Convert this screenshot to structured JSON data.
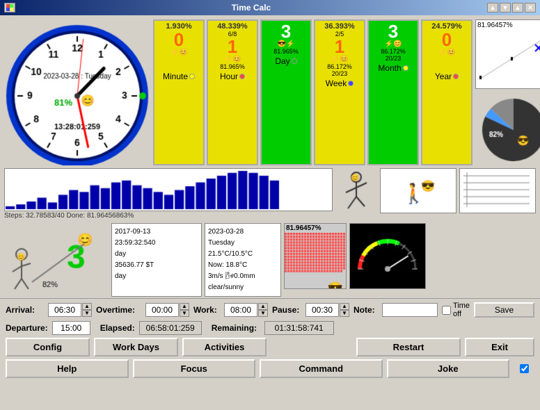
{
  "window": {
    "title": "Time Calc",
    "controls": [
      "▲",
      "▼",
      "▲",
      "✕"
    ]
  },
  "clock": {
    "date": "2023-03-28 : Tuesday",
    "time": "13:28:01:259",
    "percent": "81%"
  },
  "stats": [
    {
      "id": "minute",
      "percent": "1.930%",
      "fraction": "",
      "big": "0",
      "icons": "⚡😊",
      "sub_percent": "",
      "sub_fraction": "",
      "label": "Minute",
      "dot": "yellow",
      "bg": "yellow"
    },
    {
      "id": "hour",
      "percent": "48.339%",
      "fraction": "6/8",
      "big": "1",
      "icons": "⚡😊",
      "sub_percent": "81.965%",
      "sub_fraction": "",
      "label": "Hour",
      "dot": "red",
      "bg": "yellow"
    },
    {
      "id": "day",
      "percent": "",
      "fraction": "",
      "big": "3",
      "icons": "😎⚡",
      "sub_percent": "81.965%",
      "sub_fraction": "",
      "label": "Day",
      "dot": "green",
      "bg": "green"
    },
    {
      "id": "week",
      "percent": "36.393%",
      "fraction": "2/5",
      "big": "1",
      "icons": "⚡😊",
      "sub_percent": "86.172%",
      "sub_fraction": "20/23",
      "label": "Week",
      "dot": "blue",
      "bg": "yellow"
    },
    {
      "id": "month",
      "percent": "",
      "fraction": "",
      "big": "3",
      "icons": "⚡😊",
      "sub_percent": "86.172%",
      "sub_fraction": "20/23",
      "label": "Month",
      "dot": "yellow",
      "bg": "green"
    },
    {
      "id": "year",
      "percent": "24.579%",
      "fraction": "",
      "big": "0",
      "icons": "⚡😊",
      "sub_percent": "",
      "sub_fraction": "",
      "label": "Year",
      "dot": "red",
      "bg": "yellow"
    }
  ],
  "right_panel": {
    "percent": "81.96457%"
  },
  "steps": {
    "label": "Steps: 32.78583/40 Done: 81.96456863%"
  },
  "info": {
    "date1": "2017-09-13",
    "time1": "23:59:32:540",
    "unit1": "day",
    "amount": "35636.77 $T",
    "unit2": "day",
    "date2": "2023-03-28",
    "day2": "Tuesday",
    "temp": "21.5°C/10.5°C",
    "now": "Now: 18.8°C",
    "wind": "3m/s 🌬0.0mm",
    "sky": "clear/sunny"
  },
  "pixel_percent": "81.96457%",
  "controls": {
    "arrival_label": "Arrival:",
    "arrival_val": "06:30",
    "overtime_label": "Overtime:",
    "overtime_val": "00:00",
    "work_label": "Work:",
    "work_val": "08:00",
    "pause_label": "Pause:",
    "pause_val": "00:30",
    "note_label": "Note:",
    "note_val": "",
    "timeoff_label": "Time off",
    "departure_label": "Departure:",
    "departure_val": "15:00",
    "elapsed_label": "Elapsed:",
    "elapsed_val": "06:58:01:259",
    "remaining_label": "Remaining:",
    "remaining_val": "01:31:58:741",
    "save_label": "Save"
  },
  "buttons_row1": {
    "config": "Config",
    "workdays": "Work Days",
    "activities": "Activities",
    "restart": "Restart",
    "exit": "Exit"
  },
  "buttons_row2": {
    "help": "Help",
    "focus": "Focus",
    "command": "Command",
    "joke": "Joke"
  }
}
